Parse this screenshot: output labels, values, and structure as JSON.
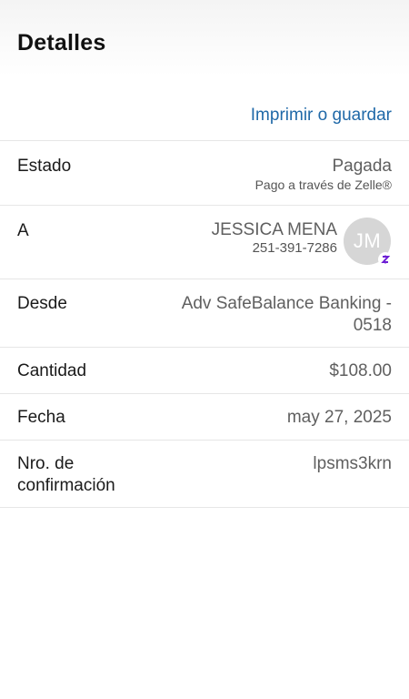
{
  "header": {
    "title": "Detalles"
  },
  "actions": {
    "print_label": "Imprimir o guardar"
  },
  "status": {
    "label": "Estado",
    "value": "Pagada",
    "subtext": "Pago a través de Zelle®"
  },
  "recipient": {
    "label": "A",
    "name": "JESSICA MENA",
    "phone": "251-391-7286",
    "initials": "JM"
  },
  "from": {
    "label": "Desde",
    "value_line1": "Adv SafeBalance Banking -",
    "value_line2": "0518"
  },
  "amount": {
    "label": "Cantidad",
    "value": "$108.00"
  },
  "date": {
    "label": "Fecha",
    "value": "may 27, 2025"
  },
  "confirmation": {
    "label_line1": "Nro. de",
    "label_line2": "confirmación",
    "value": "lpsms3krn"
  },
  "colors": {
    "link": "#2069a8",
    "zelle_purple": "#6d1ed4",
    "avatar_bg": "#d6d6d6"
  }
}
